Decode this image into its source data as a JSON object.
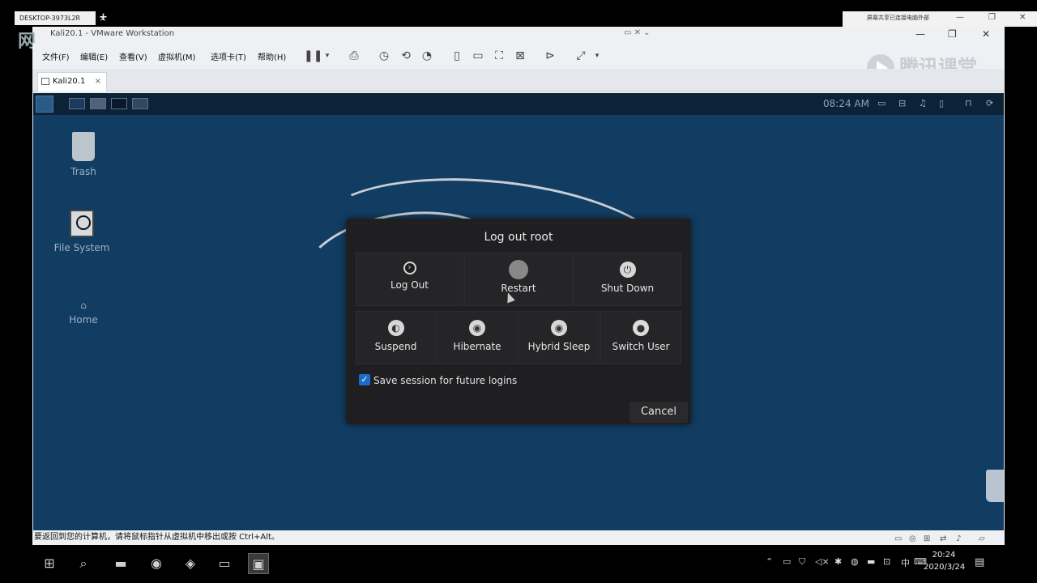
{
  "remote_desktop": {
    "tab_label": "DESKTOP-3973L2R",
    "right_title": "屏幕共享已连接电脑外部"
  },
  "vmware": {
    "watermark_left": "网",
    "window_title": "Kali20.1 - VMware Workstation",
    "menus": [
      "文件(F)",
      "编辑(E)",
      "查看(V)",
      "虚拟机(M)",
      "选项卡(T)",
      "帮助(H)"
    ],
    "brand": "腾讯课堂",
    "tab_label": "Kali20.1",
    "status_text": "要返回到您的计算机，请将鼠标指针从虚拟机中移出或按 Ctrl+Alt。"
  },
  "guest": {
    "clock": "08:24 AM",
    "desktop_icons": [
      {
        "label": "Trash",
        "icon": "trash-icon"
      },
      {
        "label": "File System",
        "icon": "drive-icon"
      },
      {
        "label": "Home",
        "icon": "home-icon"
      }
    ]
  },
  "dialog": {
    "title": "Log out root",
    "row1": [
      {
        "label": "Log Out",
        "icon": "logout-icon"
      },
      {
        "label": "Restart",
        "icon": "restart-icon"
      },
      {
        "label": "Shut Down",
        "icon": "shutdown-icon"
      }
    ],
    "row2": [
      {
        "label": "Suspend",
        "icon": "suspend-icon"
      },
      {
        "label": "Hibernate",
        "icon": "hibernate-icon"
      },
      {
        "label": "Hybrid Sleep",
        "icon": "hybrid-sleep-icon"
      },
      {
        "label": "Switch User",
        "icon": "user-icon"
      }
    ],
    "save_session_label": "Save session for future logins",
    "save_session_checked": true,
    "cancel_label": "Cancel"
  },
  "taskbar": {
    "time": "20:24",
    "date": "2020/3/24",
    "ime": "中"
  },
  "colors": {
    "guest_desktop": "#123d63",
    "dialog_bg": "#1f1f21",
    "checkbox": "#1a6cc8"
  }
}
